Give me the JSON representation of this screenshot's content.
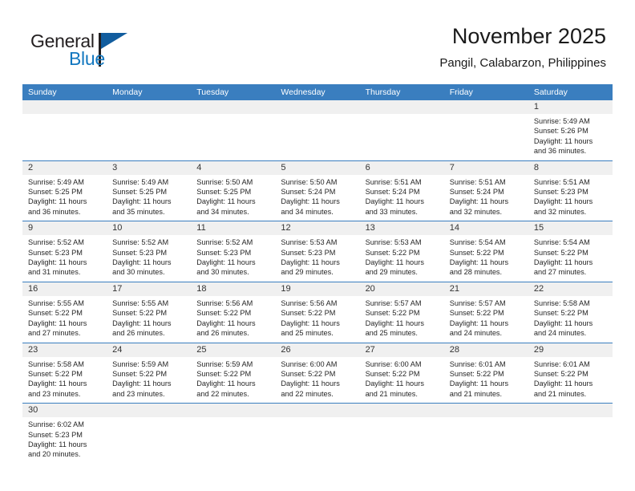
{
  "branding": {
    "logo_text_top": "General",
    "logo_text_bottom": "Blue",
    "logo_icon": "flag-triangle-icon"
  },
  "header": {
    "title": "November 2025",
    "subtitle": "Pangil, Calabarzon, Philippines"
  },
  "colors": {
    "header_blue": "#3a7ebf",
    "daynum_band": "#f0f0f0",
    "logo_blue": "#1277bf",
    "logo_dark": "#125d9e",
    "text": "#262626"
  },
  "weekdays": [
    "Sunday",
    "Monday",
    "Tuesday",
    "Wednesday",
    "Thursday",
    "Friday",
    "Saturday"
  ],
  "weeks": [
    [
      {
        "day": "",
        "lines": []
      },
      {
        "day": "",
        "lines": []
      },
      {
        "day": "",
        "lines": []
      },
      {
        "day": "",
        "lines": []
      },
      {
        "day": "",
        "lines": []
      },
      {
        "day": "",
        "lines": []
      },
      {
        "day": "1",
        "lines": [
          "Sunrise: 5:49 AM",
          "Sunset: 5:26 PM",
          "Daylight: 11 hours",
          "and 36 minutes."
        ]
      }
    ],
    [
      {
        "day": "2",
        "lines": [
          "Sunrise: 5:49 AM",
          "Sunset: 5:25 PM",
          "Daylight: 11 hours",
          "and 36 minutes."
        ]
      },
      {
        "day": "3",
        "lines": [
          "Sunrise: 5:49 AM",
          "Sunset: 5:25 PM",
          "Daylight: 11 hours",
          "and 35 minutes."
        ]
      },
      {
        "day": "4",
        "lines": [
          "Sunrise: 5:50 AM",
          "Sunset: 5:25 PM",
          "Daylight: 11 hours",
          "and 34 minutes."
        ]
      },
      {
        "day": "5",
        "lines": [
          "Sunrise: 5:50 AM",
          "Sunset: 5:24 PM",
          "Daylight: 11 hours",
          "and 34 minutes."
        ]
      },
      {
        "day": "6",
        "lines": [
          "Sunrise: 5:51 AM",
          "Sunset: 5:24 PM",
          "Daylight: 11 hours",
          "and 33 minutes."
        ]
      },
      {
        "day": "7",
        "lines": [
          "Sunrise: 5:51 AM",
          "Sunset: 5:24 PM",
          "Daylight: 11 hours",
          "and 32 minutes."
        ]
      },
      {
        "day": "8",
        "lines": [
          "Sunrise: 5:51 AM",
          "Sunset: 5:23 PM",
          "Daylight: 11 hours",
          "and 32 minutes."
        ]
      }
    ],
    [
      {
        "day": "9",
        "lines": [
          "Sunrise: 5:52 AM",
          "Sunset: 5:23 PM",
          "Daylight: 11 hours",
          "and 31 minutes."
        ]
      },
      {
        "day": "10",
        "lines": [
          "Sunrise: 5:52 AM",
          "Sunset: 5:23 PM",
          "Daylight: 11 hours",
          "and 30 minutes."
        ]
      },
      {
        "day": "11",
        "lines": [
          "Sunrise: 5:52 AM",
          "Sunset: 5:23 PM",
          "Daylight: 11 hours",
          "and 30 minutes."
        ]
      },
      {
        "day": "12",
        "lines": [
          "Sunrise: 5:53 AM",
          "Sunset: 5:23 PM",
          "Daylight: 11 hours",
          "and 29 minutes."
        ]
      },
      {
        "day": "13",
        "lines": [
          "Sunrise: 5:53 AM",
          "Sunset: 5:22 PM",
          "Daylight: 11 hours",
          "and 29 minutes."
        ]
      },
      {
        "day": "14",
        "lines": [
          "Sunrise: 5:54 AM",
          "Sunset: 5:22 PM",
          "Daylight: 11 hours",
          "and 28 minutes."
        ]
      },
      {
        "day": "15",
        "lines": [
          "Sunrise: 5:54 AM",
          "Sunset: 5:22 PM",
          "Daylight: 11 hours",
          "and 27 minutes."
        ]
      }
    ],
    [
      {
        "day": "16",
        "lines": [
          "Sunrise: 5:55 AM",
          "Sunset: 5:22 PM",
          "Daylight: 11 hours",
          "and 27 minutes."
        ]
      },
      {
        "day": "17",
        "lines": [
          "Sunrise: 5:55 AM",
          "Sunset: 5:22 PM",
          "Daylight: 11 hours",
          "and 26 minutes."
        ]
      },
      {
        "day": "18",
        "lines": [
          "Sunrise: 5:56 AM",
          "Sunset: 5:22 PM",
          "Daylight: 11 hours",
          "and 26 minutes."
        ]
      },
      {
        "day": "19",
        "lines": [
          "Sunrise: 5:56 AM",
          "Sunset: 5:22 PM",
          "Daylight: 11 hours",
          "and 25 minutes."
        ]
      },
      {
        "day": "20",
        "lines": [
          "Sunrise: 5:57 AM",
          "Sunset: 5:22 PM",
          "Daylight: 11 hours",
          "and 25 minutes."
        ]
      },
      {
        "day": "21",
        "lines": [
          "Sunrise: 5:57 AM",
          "Sunset: 5:22 PM",
          "Daylight: 11 hours",
          "and 24 minutes."
        ]
      },
      {
        "day": "22",
        "lines": [
          "Sunrise: 5:58 AM",
          "Sunset: 5:22 PM",
          "Daylight: 11 hours",
          "and 24 minutes."
        ]
      }
    ],
    [
      {
        "day": "23",
        "lines": [
          "Sunrise: 5:58 AM",
          "Sunset: 5:22 PM",
          "Daylight: 11 hours",
          "and 23 minutes."
        ]
      },
      {
        "day": "24",
        "lines": [
          "Sunrise: 5:59 AM",
          "Sunset: 5:22 PM",
          "Daylight: 11 hours",
          "and 23 minutes."
        ]
      },
      {
        "day": "25",
        "lines": [
          "Sunrise: 5:59 AM",
          "Sunset: 5:22 PM",
          "Daylight: 11 hours",
          "and 22 minutes."
        ]
      },
      {
        "day": "26",
        "lines": [
          "Sunrise: 6:00 AM",
          "Sunset: 5:22 PM",
          "Daylight: 11 hours",
          "and 22 minutes."
        ]
      },
      {
        "day": "27",
        "lines": [
          "Sunrise: 6:00 AM",
          "Sunset: 5:22 PM",
          "Daylight: 11 hours",
          "and 21 minutes."
        ]
      },
      {
        "day": "28",
        "lines": [
          "Sunrise: 6:01 AM",
          "Sunset: 5:22 PM",
          "Daylight: 11 hours",
          "and 21 minutes."
        ]
      },
      {
        "day": "29",
        "lines": [
          "Sunrise: 6:01 AM",
          "Sunset: 5:22 PM",
          "Daylight: 11 hours",
          "and 21 minutes."
        ]
      }
    ],
    [
      {
        "day": "30",
        "lines": [
          "Sunrise: 6:02 AM",
          "Sunset: 5:23 PM",
          "Daylight: 11 hours",
          "and 20 minutes."
        ]
      },
      {
        "day": "",
        "lines": []
      },
      {
        "day": "",
        "lines": []
      },
      {
        "day": "",
        "lines": []
      },
      {
        "day": "",
        "lines": []
      },
      {
        "day": "",
        "lines": []
      },
      {
        "day": "",
        "lines": []
      }
    ]
  ]
}
